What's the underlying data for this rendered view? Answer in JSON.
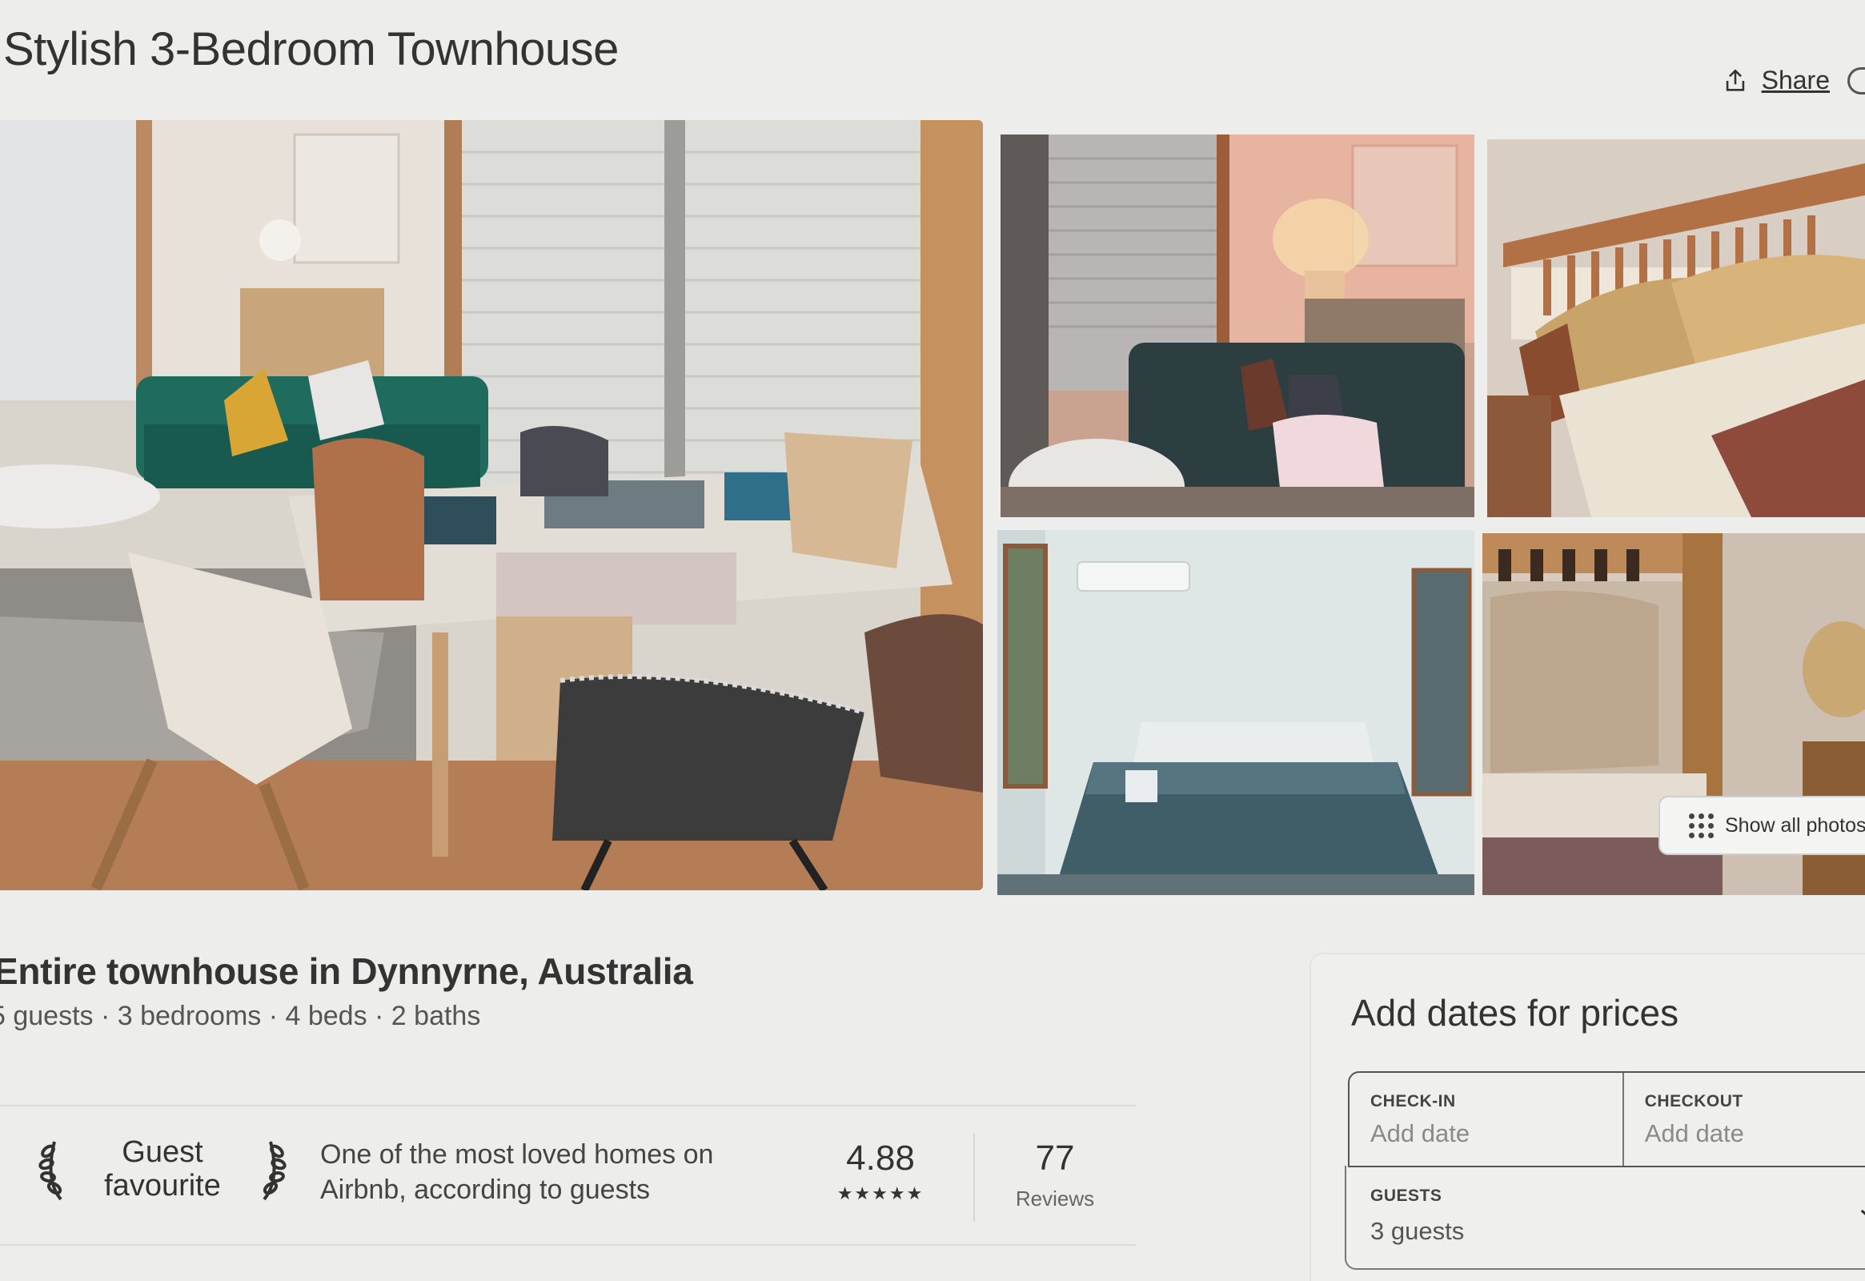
{
  "header": {
    "title": "Stylish 3-Bedroom Townhouse",
    "share_label": "Share"
  },
  "gallery": {
    "show_all_label": "Show all photos"
  },
  "listing": {
    "title": "Entire townhouse in Dynnyrne, Australia",
    "meta": "5 guests · 3 bedrooms · 4 beds · 2 baths"
  },
  "guest_favourite": {
    "badge_line1": "Guest",
    "badge_line2": "favourite",
    "description_line1": "One of the most loved homes on",
    "description_line2": "Airbnb, according to guests",
    "rating": "4.88",
    "stars": "★★★★★",
    "reviews_count": "77",
    "reviews_label": "Reviews"
  },
  "booking": {
    "heading": "Add dates for prices",
    "checkin_label": "CHECK-IN",
    "checkin_value": "Add date",
    "checkout_label": "CHECKOUT",
    "checkout_value": "Add date",
    "guests_label": "GUESTS",
    "guests_value": "3 guests"
  },
  "icons": {
    "share": "share-icon",
    "grid": "grid-dots-icon",
    "laurel": "laurel-icon",
    "chevron": "chevron-down-icon"
  }
}
